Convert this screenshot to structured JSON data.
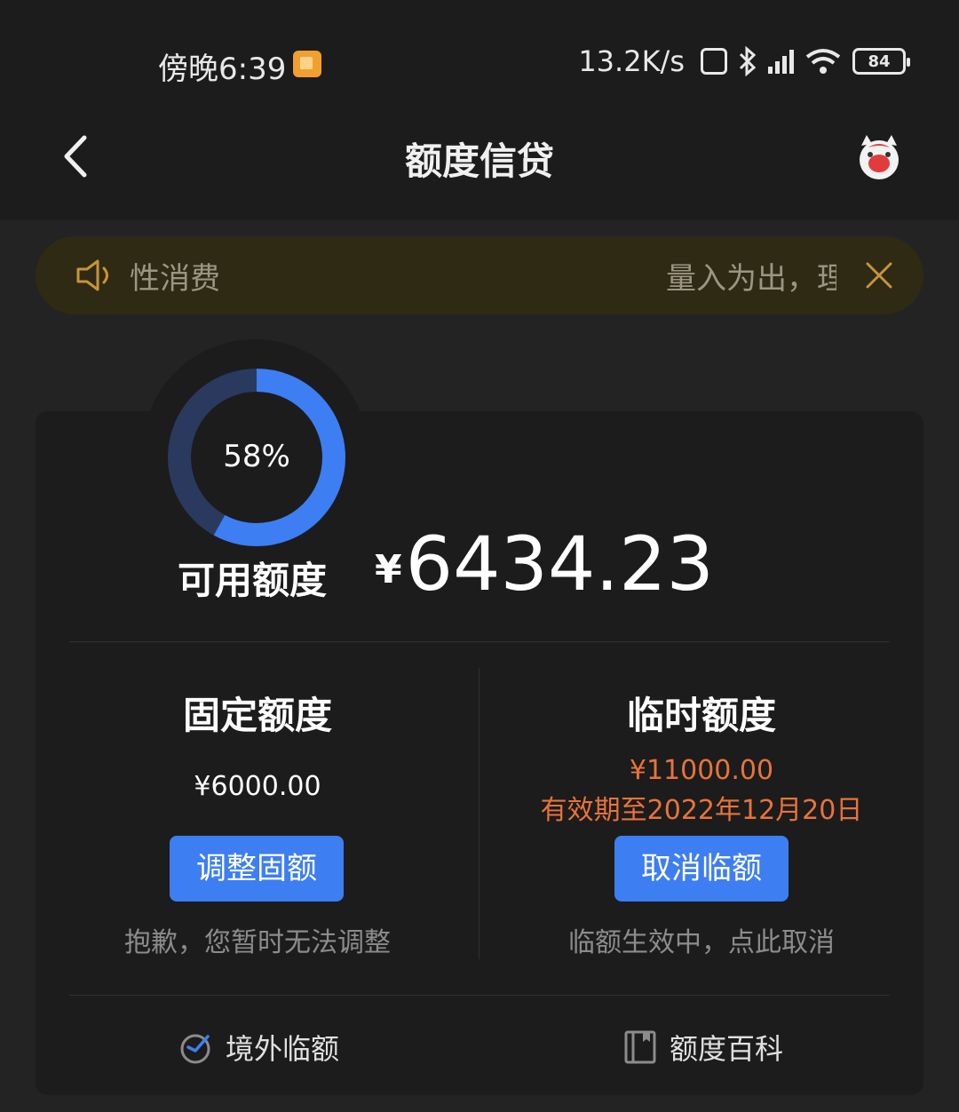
{
  "status_bar": {
    "time": "傍晚6:39",
    "net_speed": "13.2K/s",
    "battery": "84",
    "icons": [
      "notification-icon",
      "nfc-icon",
      "bluetooth-icon",
      "hd-signal-icon",
      "wifi-icon",
      "battery-icon"
    ]
  },
  "header": {
    "title": "额度信贷",
    "icons": [
      "back-icon",
      "mascot-icon"
    ]
  },
  "notice": {
    "text_left": "性消费",
    "text_right": "量入为出，理",
    "icons": [
      "speaker-icon",
      "close-icon"
    ]
  },
  "credit": {
    "usage_percent_label": "58%",
    "usage_fraction": 0.58,
    "available_label": "可用额度",
    "currency": "¥",
    "available_amount": "6434.23"
  },
  "fixed_quota": {
    "title": "固定额度",
    "amount": "¥6000.00",
    "button": "调整固额",
    "hint": "抱歉，您暂时无法调整"
  },
  "temp_quota": {
    "title": "临时额度",
    "amount": "¥11000.00",
    "expiry": "有效期至2022年12月20日",
    "button": "取消临额",
    "hint": "临额生效中，点此取消"
  },
  "bottom_links": {
    "overseas": "境外临额",
    "encyclopedia": "额度百科",
    "icons": [
      "globe-plane-icon",
      "book-icon"
    ]
  },
  "colors": {
    "accent": "#3d7ef3",
    "warning": "#e9733a",
    "background": "#232323",
    "card": "#1c1c1c"
  }
}
